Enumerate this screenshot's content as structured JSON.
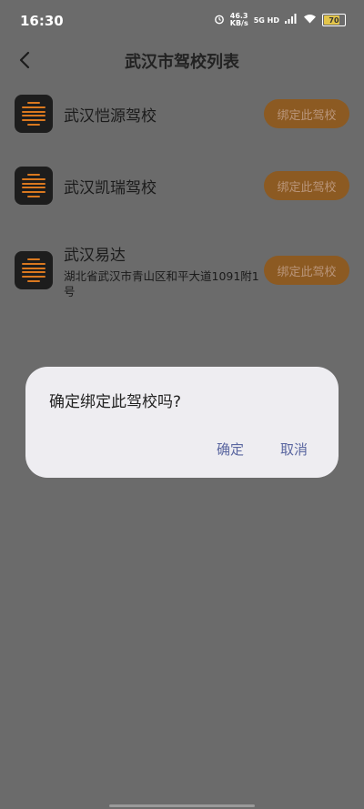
{
  "status_bar": {
    "time": "16:30",
    "speed_value": "46.3",
    "speed_unit": "KB/s",
    "signal_label": "5G HD",
    "battery": "70"
  },
  "nav": {
    "title": "武汉市驾校列表"
  },
  "schools": [
    {
      "name": "武汉恺源驾校",
      "address": "",
      "bind_label": "绑定此驾校"
    },
    {
      "name": "武汉凯瑞驾校",
      "address": "",
      "bind_label": "绑定此驾校"
    },
    {
      "name": "武汉易达",
      "address": "湖北省武汉市青山区和平大道1091附1号",
      "bind_label": "绑定此驾校"
    }
  ],
  "dialog": {
    "message": "确定绑定此驾校吗?",
    "confirm_label": "确定",
    "cancel_label": "取消"
  },
  "colors": {
    "overlay_bg": "#6b6b6b",
    "bind_button": "#8c5a22",
    "dialog_bg": "#eeedf1",
    "dialog_button_text": "#5a66a0"
  }
}
